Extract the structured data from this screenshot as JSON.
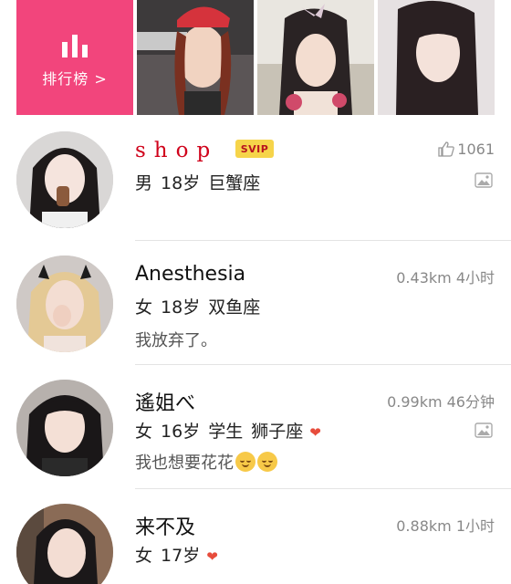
{
  "top_banner": {
    "ranking_label": "排行榜 >",
    "ranking_color": "#f2457c"
  },
  "users": [
    {
      "name": "shop",
      "badge": "SVIP",
      "gender": "男",
      "age": "18岁",
      "zodiac": "巨蟹座",
      "likes": "1061",
      "has_photos": true
    },
    {
      "name": "Anesthesia",
      "gender": "女",
      "age": "18岁",
      "zodiac": "双鱼座",
      "status": "我放弃了。",
      "distance_time": "0.43km 4小时"
    },
    {
      "name": "遙姐べ",
      "gender": "女",
      "age": "16岁",
      "occupation": "学生",
      "zodiac": "狮子座",
      "status": "我也想要花花",
      "distance_time": "0.99km 46分钟",
      "has_photos": true,
      "status_emoji": "relieved-face-emoji"
    },
    {
      "name": "来不及",
      "gender": "女",
      "age": "17岁",
      "distance_time": "0.88km 1小时"
    }
  ],
  "colors": {
    "accent_pink": "#f2457c",
    "vip_name_red": "#d0021b",
    "svip_badge_yellow": "#f6d44a",
    "heart_red": "#e74c3c"
  },
  "icons": [
    "bar-chart-icon",
    "thumbs-up-icon",
    "photo-icon",
    "heart-icon"
  ]
}
